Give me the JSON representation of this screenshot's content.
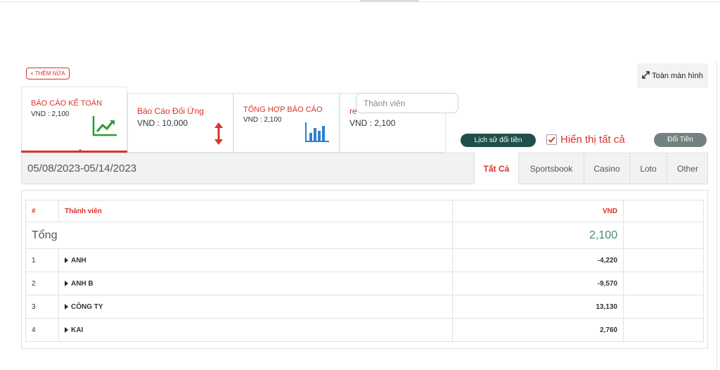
{
  "add_more_label": "+ THÊM NỮA",
  "fullscreen_label": "Toàn màn hình",
  "cards": [
    {
      "title": "BÁO CÁO KẾ TOÁN",
      "value": "VND : 2,100",
      "icon": "trend-up-chart-icon",
      "color": "#2e9a3a"
    },
    {
      "title": "Báo Cáo Đối Ứng",
      "value": "VND : 10,000",
      "icon": "up-down-arrow-icon",
      "color": "#d9342b"
    },
    {
      "title": "TỔNG HỢP BÁO CÁO",
      "value": "VND : 2,100",
      "icon": "bar-chart-icon",
      "color": "#2f7fd0"
    },
    {
      "title": "re",
      "value": "VND : 2,100"
    }
  ],
  "member_search": {
    "placeholder": "Thành viên",
    "value": ""
  },
  "history_button": "Lịch sử đổi tiền",
  "show_all": {
    "label": "Hiển thị tất cả",
    "checked": true
  },
  "exchange_button": "Đổi Tiền",
  "date_range": "05/08/2023-05/14/2023",
  "filters": [
    "Tất Cả",
    "Sportsbook",
    "Casino",
    "Loto",
    "Other"
  ],
  "table": {
    "headers": {
      "index": "#",
      "member": "Thành viên",
      "currency": "VND"
    },
    "total": {
      "label": "Tổng",
      "value": "2,100"
    },
    "rows": [
      {
        "index": "1",
        "member": "ANH",
        "amount": "-4,220"
      },
      {
        "index": "2",
        "member": "ANH B",
        "amount": "-9,570"
      },
      {
        "index": "3",
        "member": "CÔNG TY",
        "amount": "13,130"
      },
      {
        "index": "4",
        "member": "KAI",
        "amount": "2,760"
      }
    ]
  },
  "colors": {
    "accent": "#d9342b",
    "positive": "#3d8a80",
    "dark_button": "#1f4f4a",
    "grey_button": "#718380"
  }
}
